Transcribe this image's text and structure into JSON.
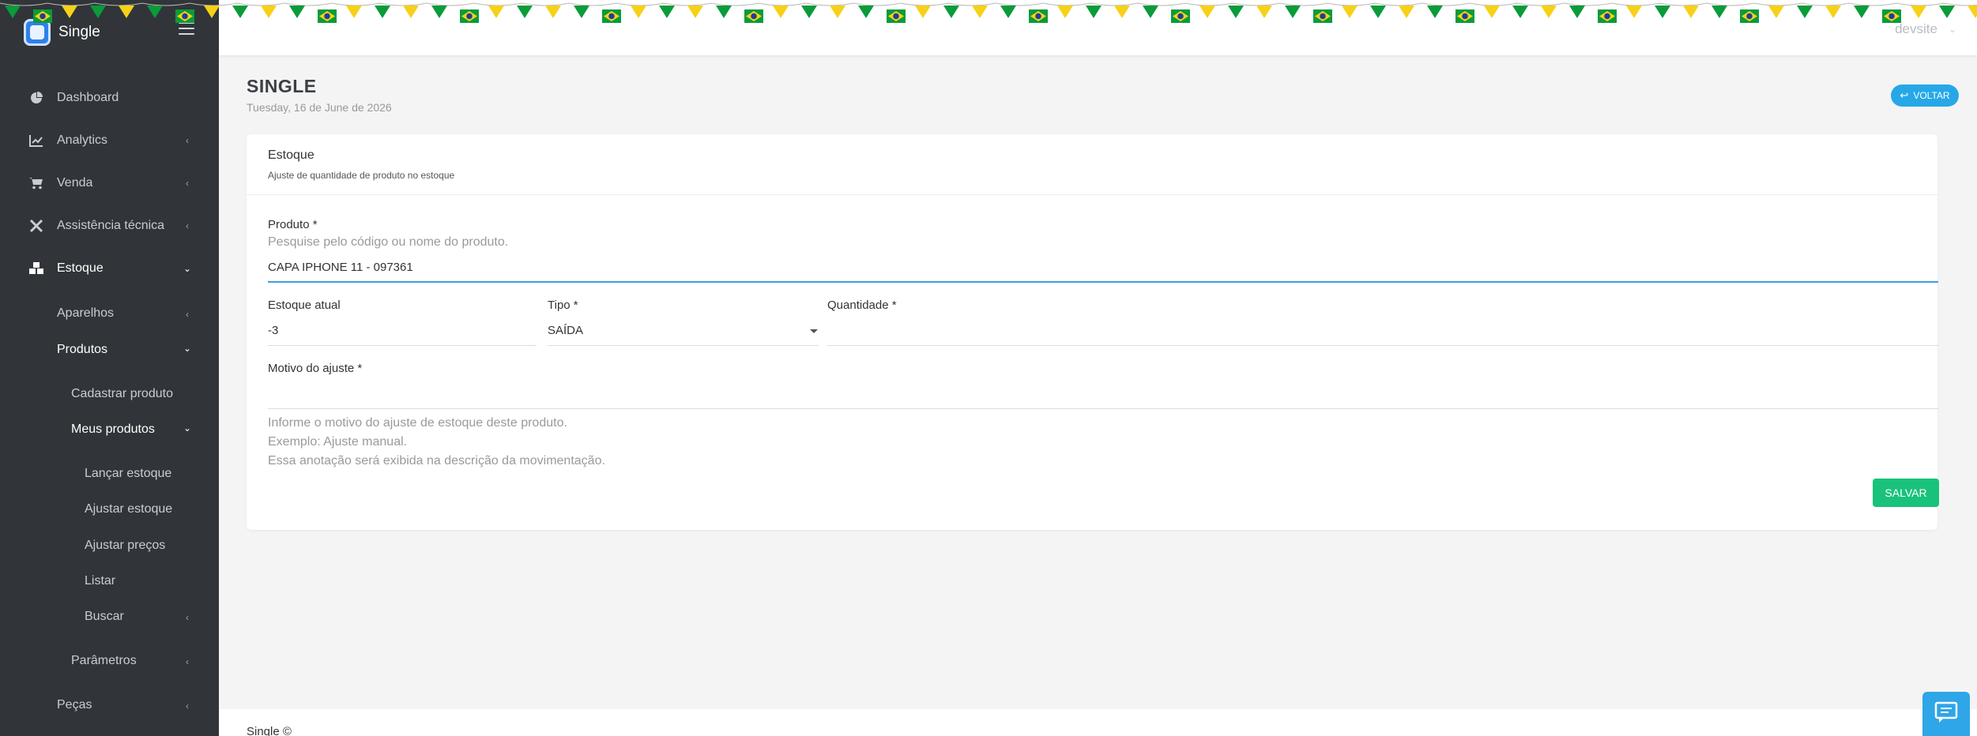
{
  "brand": {
    "name": "Single"
  },
  "sidebar": {
    "items": [
      {
        "label": "Dashboard"
      },
      {
        "label": "Analytics"
      },
      {
        "label": "Venda"
      },
      {
        "label": "Assistência técnica"
      },
      {
        "label": "Estoque"
      },
      {
        "label": "Aparelhos"
      },
      {
        "label": "Produtos"
      },
      {
        "label": "Cadastrar produto"
      },
      {
        "label": "Meus produtos"
      },
      {
        "label": "Lançar estoque"
      },
      {
        "label": "Ajustar estoque"
      },
      {
        "label": "Ajustar preços"
      },
      {
        "label": "Listar"
      },
      {
        "label": "Buscar"
      },
      {
        "label": "Parâmetros"
      },
      {
        "label": "Peças"
      }
    ]
  },
  "topbar": {
    "user": "devsite"
  },
  "page": {
    "title": "SINGLE",
    "date": "Tuesday, 16 de June de 2026",
    "back_label": "VOLTAR"
  },
  "card": {
    "title": "Estoque",
    "subtitle": "Ajuste de quantidade de produto no estoque",
    "produto": {
      "label": "Produto *",
      "hint": "Pesquise pelo código ou nome do produto.",
      "value": "CAPA IPHONE 11 - 097361"
    },
    "estoque_atual": {
      "label": "Estoque atual",
      "value": "-3"
    },
    "tipo": {
      "label": "Tipo *",
      "value": "SAÍDA"
    },
    "quantidade": {
      "label": "Quantidade *",
      "value": ""
    },
    "motivo": {
      "label": "Motivo do ajuste *",
      "hint_line1": "Informe o motivo do ajuste de estoque deste produto.",
      "hint_line2": "Exemplo: Ajuste manual.",
      "hint_line3": "Essa anotação será exibida na descrição da movimentação."
    },
    "save_label": "SALVAR"
  },
  "footer": {
    "text": "Single ©"
  },
  "colors": {
    "sidebar_bg": "#313539",
    "accent_blue": "#26a8e8",
    "save_green": "#19c27b",
    "flag_green": "#0a9b3a",
    "flag_yellow": "#f7d117",
    "flag_blue": "#1f3f99"
  },
  "icons": {
    "dashboard": "pie-chart-icon",
    "analytics": "line-chart-icon",
    "venda": "cart-icon",
    "assistencia": "tools-icon",
    "estoque": "boxes-icon",
    "back": "return-arrow-icon",
    "chat": "chat-icon"
  }
}
